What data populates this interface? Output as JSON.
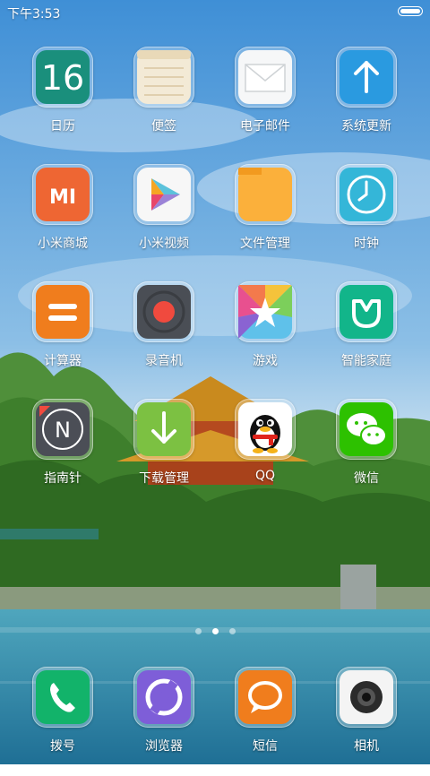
{
  "status_bar": {
    "time": "下午3:53",
    "battery_level": 1.0
  },
  "apps": [
    {
      "label": "日历",
      "icon": "calendar-icon",
      "date_number": "16"
    },
    {
      "label": "便签",
      "icon": "notes-icon"
    },
    {
      "label": "电子邮件",
      "icon": "email-icon"
    },
    {
      "label": "系统更新",
      "icon": "update-icon"
    },
    {
      "label": "小米商城",
      "icon": "mi-store-icon",
      "logo_text": "MI"
    },
    {
      "label": "小米视频",
      "icon": "mi-video-icon"
    },
    {
      "label": "文件管理",
      "icon": "folder-icon"
    },
    {
      "label": "时钟",
      "icon": "clock-icon"
    },
    {
      "label": "计算器",
      "icon": "calculator-icon"
    },
    {
      "label": "录音机",
      "icon": "recorder-icon"
    },
    {
      "label": "游戏",
      "icon": "games-icon"
    },
    {
      "label": "智能家庭",
      "icon": "smart-home-icon"
    },
    {
      "label": "指南针",
      "icon": "compass-icon",
      "logo_text": "N"
    },
    {
      "label": "下载管理",
      "icon": "download-icon"
    },
    {
      "label": "QQ",
      "icon": "qq-icon"
    },
    {
      "label": "微信",
      "icon": "wechat-icon"
    }
  ],
  "page_indicator": {
    "pages": 3,
    "current": 2
  },
  "dock": [
    {
      "label": "拨号",
      "icon": "phone-icon"
    },
    {
      "label": "浏览器",
      "icon": "browser-icon"
    },
    {
      "label": "短信",
      "icon": "messages-icon"
    },
    {
      "label": "相机",
      "icon": "camera-icon"
    }
  ],
  "colors": {
    "sky": "#4d95d3",
    "water": "#2f8aa8",
    "label_text": "#ffffff"
  }
}
